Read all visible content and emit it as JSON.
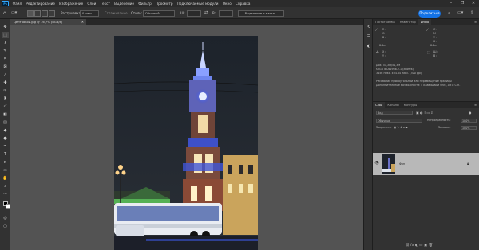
{
  "app": {
    "logo_text": "Ps"
  },
  "menu": [
    "Файл",
    "Редактирование",
    "Изображение",
    "Слои",
    "Текст",
    "Выделение",
    "Фильтр",
    "Просмотр",
    "Подключаемые модули",
    "Окно",
    "Справка"
  ],
  "options_bar": {
    "feather_label": "Растушевка:",
    "feather_value": "0 пикс.",
    "antialias_label": "Сглаживание",
    "style_label": "Стиль:",
    "style_value": "Обычный",
    "width_label": "Ш:",
    "height_label": "В:",
    "select_mask_label": "Выделение и маска...",
    "share_label": "Поделиться"
  },
  "document": {
    "tab_title": "Центровой.jpg @ 16,7% (RGB/8)"
  },
  "info_panel": {
    "tabs": [
      "Гистограмма",
      "Навигатор",
      "Инфо"
    ],
    "active_tab": "Инфо",
    "r": "R :",
    "g": "G :",
    "b": "B :",
    "c": "C :",
    "m": "M :",
    "y": "Y :",
    "k": "K :",
    "bit_left": "8-бит",
    "bit_right": "8-бит",
    "x": "X :",
    "y_coord": "Y :",
    "w": "Ш :",
    "h": "В :",
    "doc_size": "Док: 51,3M/51,3M",
    "profile": "sRGB IEC61966-2.1 (8бит/к)",
    "dimensions": "3456 пикс. x 5184 пикс. (300 ppi)",
    "hint_line1": "Рисование прямоугольной или перемещение границы",
    "hint_line2": "Дополнительные возможности: с клавишами Shift, Alt и Ctrl."
  },
  "layers_panel": {
    "tabs": [
      "Слои",
      "Каналы",
      "Контуры"
    ],
    "active_tab": "Слои",
    "search_label": "Вид",
    "blend_mode": "Обычные",
    "opacity_label": "Непрозрачность:",
    "opacity_value": "100%",
    "lock_label": "Закрепить:",
    "fill_label": "Заливка:",
    "fill_value": "100%",
    "layers": [
      {
        "name": "Фон",
        "visible": true,
        "locked": true
      }
    ]
  },
  "colors": {
    "accent": "#1473e6",
    "panel_bg": "#323232",
    "canvas_bg": "#535353",
    "menu_bg": "#2b2b2b",
    "selected_layer": "#b8b8b8"
  }
}
